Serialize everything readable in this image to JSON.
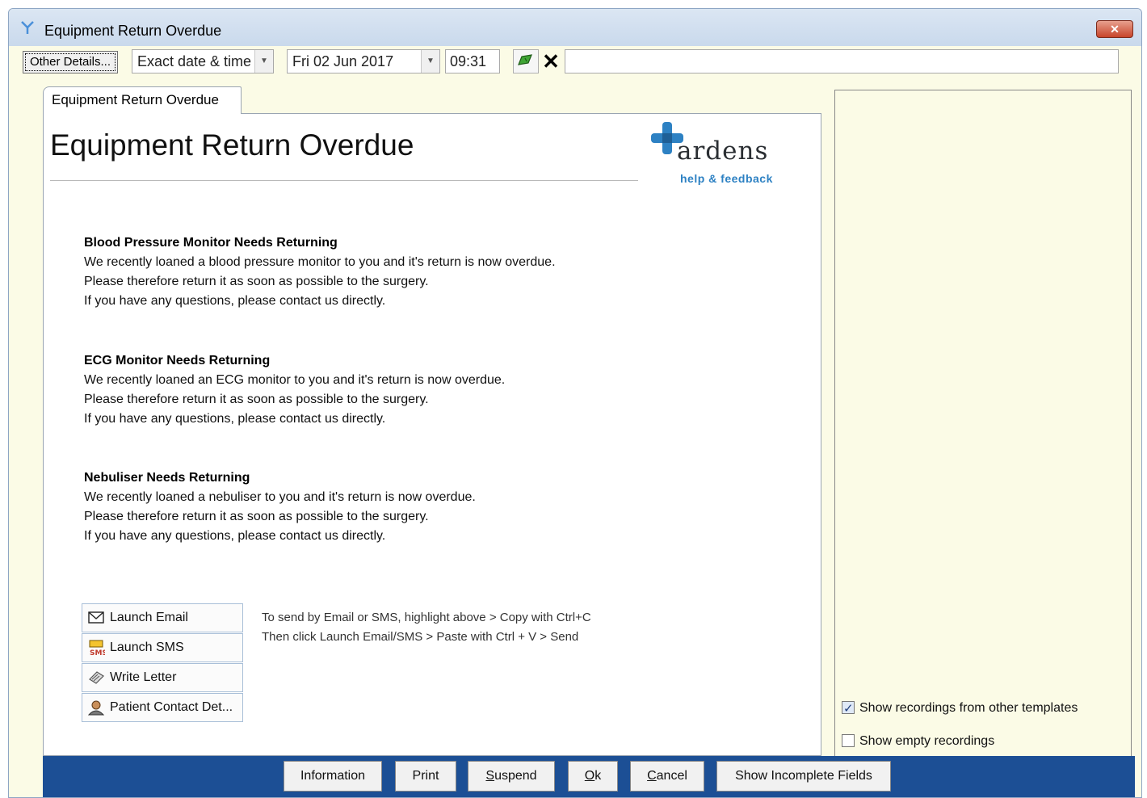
{
  "window": {
    "title": "Equipment Return Overdue",
    "close_symbol": "✕"
  },
  "toolbar": {
    "other_details_label": "Other Details...",
    "date_mode": "Exact date & time",
    "date": "Fri 02 Jun 2017",
    "time": "09:31",
    "cancel_symbol": "✕",
    "free_text_value": ""
  },
  "tab": {
    "label": "Equipment Return Overdue"
  },
  "main": {
    "title": "Equipment Return Overdue",
    "logo": {
      "word": "ardens",
      "subtitle": "help & feedback",
      "accent_color": "#2d81c3"
    },
    "sections": [
      {
        "heading": "Blood Pressure Monitor Needs Returning",
        "lines": [
          "We recently loaned a blood pressure monitor to you and it's return is now overdue.",
          "Please therefore return it as soon as possible to the surgery.",
          "If you have any questions, please contact us directly."
        ]
      },
      {
        "heading": "ECG Monitor Needs Returning",
        "lines": [
          "We recently loaned an ECG monitor to you and it's return is now overdue.",
          "Please therefore return it as soon as possible to the surgery.",
          "If you have any questions, please contact us directly."
        ]
      },
      {
        "heading": "Nebuliser Needs Returning",
        "lines": [
          "We recently loaned a nebuliser to you and it's return is now overdue.",
          "Please therefore return it as soon as possible to the surgery.",
          "If you have any questions, please contact us directly."
        ]
      }
    ],
    "actions": [
      {
        "label": "Launch Email",
        "icon": "envelope-icon"
      },
      {
        "label": "Launch SMS",
        "icon": "sms-icon"
      },
      {
        "label": "Write Letter",
        "icon": "letter-icon"
      },
      {
        "label": "Patient Contact Det...",
        "icon": "patient-icon"
      }
    ],
    "hint_lines": [
      "To send by Email or SMS, highlight above > Copy with Ctrl+C",
      "Then click Launch Email/SMS > Paste with Ctrl + V > Send"
    ]
  },
  "right_panel": {
    "show_other_templates": {
      "label": "Show recordings from other templates",
      "checked": true
    },
    "show_empty": {
      "label": "Show empty recordings",
      "checked": false
    }
  },
  "bottom_buttons": {
    "information": "Information",
    "print": "Print",
    "suspend": {
      "first": "S",
      "rest": "uspend"
    },
    "ok": {
      "first": "O",
      "rest": "k"
    },
    "cancel": {
      "first": "C",
      "rest": "ancel"
    },
    "show_incomplete": "Show Incomplete Fields"
  },
  "colors": {
    "bottom_bar": "#1c4f95",
    "panel_bg": "#fbfbe6"
  }
}
